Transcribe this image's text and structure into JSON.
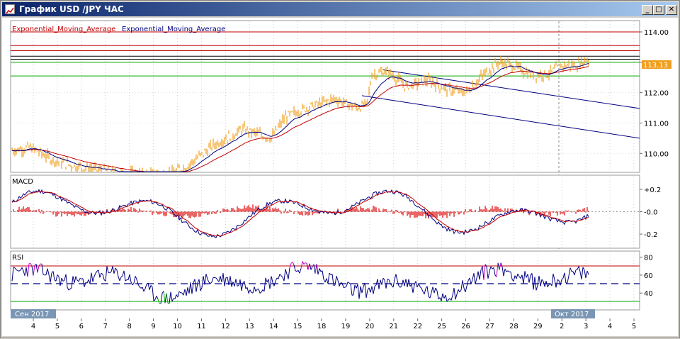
{
  "window": {
    "title": "График USD /JPY  ЧАС",
    "min_label": "_",
    "max_label": "□",
    "close_label": "✕"
  },
  "price_panel": {
    "legend": [
      {
        "text": "Exponential_Moving_Average",
        "color": "#c00000"
      },
      {
        "text": "Exponential_Moving_Average",
        "color": "#000080"
      }
    ],
    "axis_labels": [
      "114.00",
      "113.00",
      "112.00",
      "111.00",
      "110.00"
    ],
    "current_price": "113.13",
    "current_price_color": "#f0a020",
    "price_color": "#f0a020"
  },
  "macd_panel": {
    "label": "MACD",
    "axis_labels": [
      "+0.2",
      "-0.0",
      "-0.2"
    ]
  },
  "rsi_panel": {
    "label": "RSI",
    "axis_labels": [
      "80",
      "60",
      "40"
    ]
  },
  "time_axis": {
    "ticks": [
      "4",
      "5",
      "6",
      "7",
      "8",
      "9",
      "10",
      "11",
      "12",
      "13",
      "14",
      "15",
      "18",
      "19",
      "20",
      "21",
      "22",
      "25",
      "26",
      "27",
      "28",
      "29",
      "2",
      "3",
      "4",
      "5"
    ],
    "month_labels": [
      "Сен 2017",
      "Окт 2017"
    ]
  },
  "colors": {
    "ema_red": "#c00000",
    "ema_blue": "#000080",
    "macd_hist": "#dd0000",
    "rsi_line": "#000080",
    "rsi_over": "#cc00cc",
    "rsi_under": "#00aa00",
    "green_level": "#00aa00",
    "red_level": "#c00000"
  }
}
